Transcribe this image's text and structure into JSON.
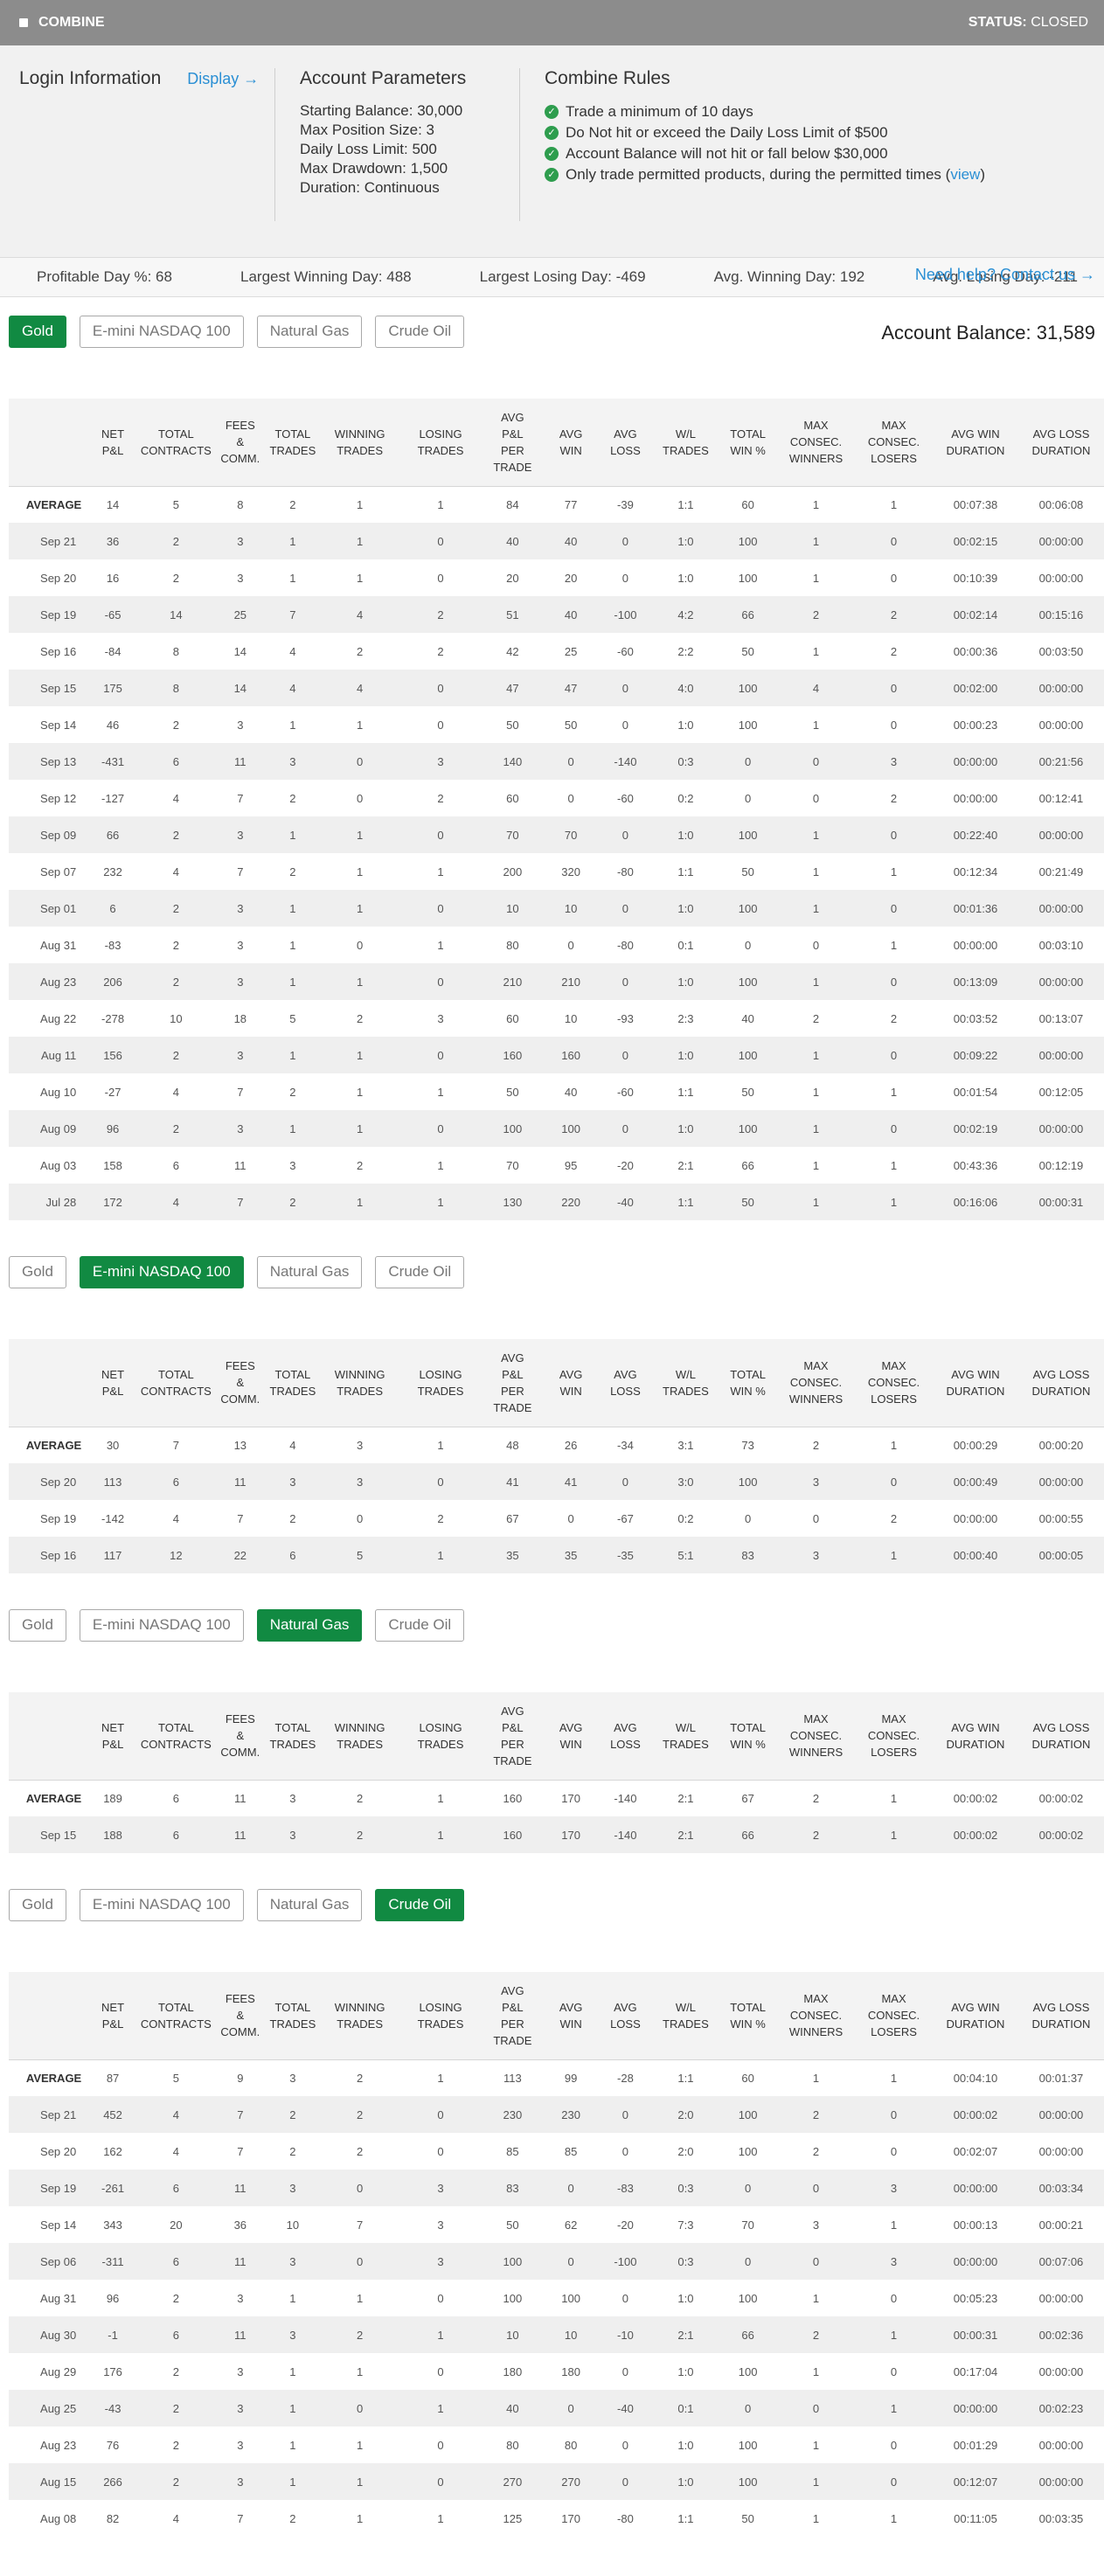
{
  "topbar": {
    "title": "COMBINE",
    "status_label": "STATUS:",
    "status_value": "CLOSED"
  },
  "login": {
    "title": "Login Information",
    "display_link": "Display →"
  },
  "account": {
    "title": "Account Parameters",
    "params": [
      "Starting Balance: 30,000",
      "Max Position Size: 3",
      "Daily Loss Limit: 500",
      "Max Drawdown: 1,500",
      "Duration: Continuous"
    ]
  },
  "rules": {
    "title": "Combine Rules",
    "items": [
      "Trade a minimum of 10 days",
      "Do Not hit or exceed the Daily Loss Limit of $500",
      "Account Balance will not hit or fall below $30,000",
      "Only trade permitted products, during the permitted times ("
    ],
    "view_link": "view",
    "view_close": ")",
    "help_link": "Need help? Contact us →"
  },
  "stats": [
    "Profitable Day %: 68",
    "Largest Winning Day: 488",
    "Largest Losing Day: -469",
    "Avg. Winning Day: 192",
    "Avg. Losing Day: -211"
  ],
  "tabs": [
    "Gold",
    "E-mini NASDAQ 100",
    "Natural Gas",
    "Crude Oil"
  ],
  "balance": "Account Balance: 31,589",
  "columns": [
    [
      "NET",
      "P&L"
    ],
    [
      "TOTAL",
      "CONTRACTS"
    ],
    [
      "FEES",
      "&",
      "COMM."
    ],
    [
      "TOTAL",
      "TRADES"
    ],
    [
      "WINNING",
      "TRADES"
    ],
    [
      "LOSING",
      "TRADES"
    ],
    [
      "AVG",
      "P&L",
      "PER",
      "TRADE"
    ],
    [
      "AVG",
      "WIN"
    ],
    [
      "AVG",
      "LOSS"
    ],
    [
      "W/L",
      "TRADES"
    ],
    [
      "TOTAL",
      "WIN %"
    ],
    [
      "MAX",
      "CONSEC.",
      "WINNERS"
    ],
    [
      "MAX",
      "CONSEC.",
      "LOSERS"
    ],
    [
      "AVG WIN",
      "DURATION"
    ],
    [
      "AVG LOSS",
      "DURATION"
    ]
  ],
  "sections": [
    {
      "active_tab": 0,
      "rows": [
        [
          "AVERAGE",
          "14",
          "5",
          "8",
          "2",
          "1",
          "1",
          "84",
          "77",
          "-39",
          "1:1",
          "60",
          "1",
          "1",
          "00:07:38",
          "00:06:08"
        ],
        [
          "Sep 21",
          "36",
          "2",
          "3",
          "1",
          "1",
          "0",
          "40",
          "40",
          "0",
          "1:0",
          "100",
          "1",
          "0",
          "00:02:15",
          "00:00:00"
        ],
        [
          "Sep 20",
          "16",
          "2",
          "3",
          "1",
          "1",
          "0",
          "20",
          "20",
          "0",
          "1:0",
          "100",
          "1",
          "0",
          "00:10:39",
          "00:00:00"
        ],
        [
          "Sep 19",
          "-65",
          "14",
          "25",
          "7",
          "4",
          "2",
          "51",
          "40",
          "-100",
          "4:2",
          "66",
          "2",
          "2",
          "00:02:14",
          "00:15:16"
        ],
        [
          "Sep 16",
          "-84",
          "8",
          "14",
          "4",
          "2",
          "2",
          "42",
          "25",
          "-60",
          "2:2",
          "50",
          "1",
          "2",
          "00:00:36",
          "00:03:50"
        ],
        [
          "Sep 15",
          "175",
          "8",
          "14",
          "4",
          "4",
          "0",
          "47",
          "47",
          "0",
          "4:0",
          "100",
          "4",
          "0",
          "00:02:00",
          "00:00:00"
        ],
        [
          "Sep 14",
          "46",
          "2",
          "3",
          "1",
          "1",
          "0",
          "50",
          "50",
          "0",
          "1:0",
          "100",
          "1",
          "0",
          "00:00:23",
          "00:00:00"
        ],
        [
          "Sep 13",
          "-431",
          "6",
          "11",
          "3",
          "0",
          "3",
          "140",
          "0",
          "-140",
          "0:3",
          "0",
          "0",
          "3",
          "00:00:00",
          "00:21:56"
        ],
        [
          "Sep 12",
          "-127",
          "4",
          "7",
          "2",
          "0",
          "2",
          "60",
          "0",
          "-60",
          "0:2",
          "0",
          "0",
          "2",
          "00:00:00",
          "00:12:41"
        ],
        [
          "Sep 09",
          "66",
          "2",
          "3",
          "1",
          "1",
          "0",
          "70",
          "70",
          "0",
          "1:0",
          "100",
          "1",
          "0",
          "00:22:40",
          "00:00:00"
        ],
        [
          "Sep 07",
          "232",
          "4",
          "7",
          "2",
          "1",
          "1",
          "200",
          "320",
          "-80",
          "1:1",
          "50",
          "1",
          "1",
          "00:12:34",
          "00:21:49"
        ],
        [
          "Sep 01",
          "6",
          "2",
          "3",
          "1",
          "1",
          "0",
          "10",
          "10",
          "0",
          "1:0",
          "100",
          "1",
          "0",
          "00:01:36",
          "00:00:00"
        ],
        [
          "Aug 31",
          "-83",
          "2",
          "3",
          "1",
          "0",
          "1",
          "80",
          "0",
          "-80",
          "0:1",
          "0",
          "0",
          "1",
          "00:00:00",
          "00:03:10"
        ],
        [
          "Aug 23",
          "206",
          "2",
          "3",
          "1",
          "1",
          "0",
          "210",
          "210",
          "0",
          "1:0",
          "100",
          "1",
          "0",
          "00:13:09",
          "00:00:00"
        ],
        [
          "Aug 22",
          "-278",
          "10",
          "18",
          "5",
          "2",
          "3",
          "60",
          "10",
          "-93",
          "2:3",
          "40",
          "2",
          "2",
          "00:03:52",
          "00:13:07"
        ],
        [
          "Aug 11",
          "156",
          "2",
          "3",
          "1",
          "1",
          "0",
          "160",
          "160",
          "0",
          "1:0",
          "100",
          "1",
          "0",
          "00:09:22",
          "00:00:00"
        ],
        [
          "Aug 10",
          "-27",
          "4",
          "7",
          "2",
          "1",
          "1",
          "50",
          "40",
          "-60",
          "1:1",
          "50",
          "1",
          "1",
          "00:01:54",
          "00:12:05"
        ],
        [
          "Aug 09",
          "96",
          "2",
          "3",
          "1",
          "1",
          "0",
          "100",
          "100",
          "0",
          "1:0",
          "100",
          "1",
          "0",
          "00:02:19",
          "00:00:00"
        ],
        [
          "Aug 03",
          "158",
          "6",
          "11",
          "3",
          "2",
          "1",
          "70",
          "95",
          "-20",
          "2:1",
          "66",
          "1",
          "1",
          "00:43:36",
          "00:12:19"
        ],
        [
          "Jul 28",
          "172",
          "4",
          "7",
          "2",
          "1",
          "1",
          "130",
          "220",
          "-40",
          "1:1",
          "50",
          "1",
          "1",
          "00:16:06",
          "00:00:31"
        ]
      ]
    },
    {
      "active_tab": 1,
      "rows": [
        [
          "AVERAGE",
          "30",
          "7",
          "13",
          "4",
          "3",
          "1",
          "48",
          "26",
          "-34",
          "3:1",
          "73",
          "2",
          "1",
          "00:00:29",
          "00:00:20"
        ],
        [
          "Sep 20",
          "113",
          "6",
          "11",
          "3",
          "3",
          "0",
          "41",
          "41",
          "0",
          "3:0",
          "100",
          "3",
          "0",
          "00:00:49",
          "00:00:00"
        ],
        [
          "Sep 19",
          "-142",
          "4",
          "7",
          "2",
          "0",
          "2",
          "67",
          "0",
          "-67",
          "0:2",
          "0",
          "0",
          "2",
          "00:00:00",
          "00:00:55"
        ],
        [
          "Sep 16",
          "117",
          "12",
          "22",
          "6",
          "5",
          "1",
          "35",
          "35",
          "-35",
          "5:1",
          "83",
          "3",
          "1",
          "00:00:40",
          "00:00:05"
        ]
      ]
    },
    {
      "active_tab": 2,
      "rows": [
        [
          "AVERAGE",
          "189",
          "6",
          "11",
          "3",
          "2",
          "1",
          "160",
          "170",
          "-140",
          "2:1",
          "67",
          "2",
          "1",
          "00:00:02",
          "00:00:02"
        ],
        [
          "Sep 15",
          "188",
          "6",
          "11",
          "3",
          "2",
          "1",
          "160",
          "170",
          "-140",
          "2:1",
          "66",
          "2",
          "1",
          "00:00:02",
          "00:00:02"
        ]
      ]
    },
    {
      "active_tab": 3,
      "rows": [
        [
          "AVERAGE",
          "87",
          "5",
          "9",
          "3",
          "2",
          "1",
          "113",
          "99",
          "-28",
          "1:1",
          "60",
          "1",
          "1",
          "00:04:10",
          "00:01:37"
        ],
        [
          "Sep 21",
          "452",
          "4",
          "7",
          "2",
          "2",
          "0",
          "230",
          "230",
          "0",
          "2:0",
          "100",
          "2",
          "0",
          "00:00:02",
          "00:00:00"
        ],
        [
          "Sep 20",
          "162",
          "4",
          "7",
          "2",
          "2",
          "0",
          "85",
          "85",
          "0",
          "2:0",
          "100",
          "2",
          "0",
          "00:02:07",
          "00:00:00"
        ],
        [
          "Sep 19",
          "-261",
          "6",
          "11",
          "3",
          "0",
          "3",
          "83",
          "0",
          "-83",
          "0:3",
          "0",
          "0",
          "3",
          "00:00:00",
          "00:03:34"
        ],
        [
          "Sep 14",
          "343",
          "20",
          "36",
          "10",
          "7",
          "3",
          "50",
          "62",
          "-20",
          "7:3",
          "70",
          "3",
          "1",
          "00:00:13",
          "00:00:21"
        ],
        [
          "Sep 06",
          "-311",
          "6",
          "11",
          "3",
          "0",
          "3",
          "100",
          "0",
          "-100",
          "0:3",
          "0",
          "0",
          "3",
          "00:00:00",
          "00:07:06"
        ],
        [
          "Aug 31",
          "96",
          "2",
          "3",
          "1",
          "1",
          "0",
          "100",
          "100",
          "0",
          "1:0",
          "100",
          "1",
          "0",
          "00:05:23",
          "00:00:00"
        ],
        [
          "Aug 30",
          "-1",
          "6",
          "11",
          "3",
          "2",
          "1",
          "10",
          "10",
          "-10",
          "2:1",
          "66",
          "2",
          "1",
          "00:00:31",
          "00:02:36"
        ],
        [
          "Aug 29",
          "176",
          "2",
          "3",
          "1",
          "1",
          "0",
          "180",
          "180",
          "0",
          "1:0",
          "100",
          "1",
          "0",
          "00:17:04",
          "00:00:00"
        ],
        [
          "Aug 25",
          "-43",
          "2",
          "3",
          "1",
          "0",
          "1",
          "40",
          "0",
          "-40",
          "0:1",
          "0",
          "0",
          "1",
          "00:00:00",
          "00:02:23"
        ],
        [
          "Aug 23",
          "76",
          "2",
          "3",
          "1",
          "1",
          "0",
          "80",
          "80",
          "0",
          "1:0",
          "100",
          "1",
          "0",
          "00:01:29",
          "00:00:00"
        ],
        [
          "Aug 15",
          "266",
          "2",
          "3",
          "1",
          "1",
          "0",
          "270",
          "270",
          "0",
          "1:0",
          "100",
          "1",
          "0",
          "00:12:07",
          "00:00:00"
        ],
        [
          "Aug 08",
          "82",
          "4",
          "7",
          "2",
          "1",
          "1",
          "125",
          "170",
          "-80",
          "1:1",
          "50",
          "1",
          "1",
          "00:11:05",
          "00:03:35"
        ]
      ]
    }
  ]
}
